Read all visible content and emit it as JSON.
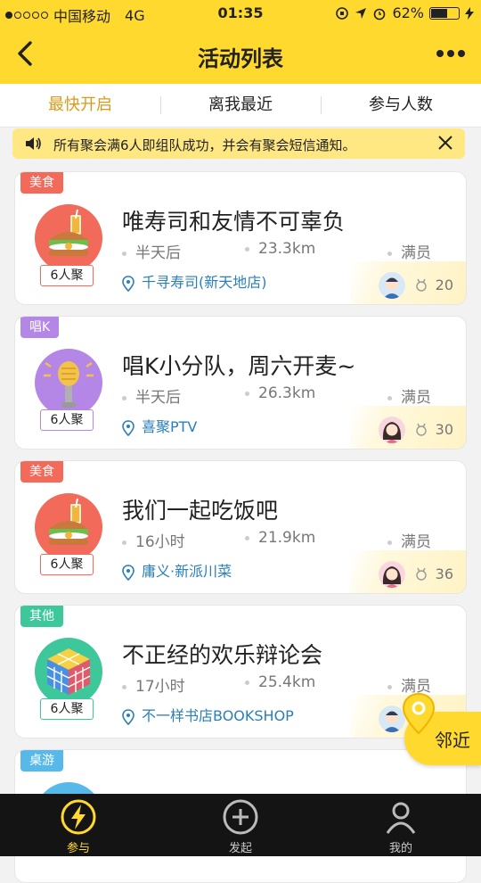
{
  "status_bar": {
    "carrier": "中国移动",
    "network": "4G",
    "time": "01:35",
    "battery": "62%",
    "battery_level": 0.62,
    "signal_filled": 1,
    "signal_total": 5
  },
  "nav": {
    "title": "活动列表",
    "back_icon": "chevron-left-icon",
    "more_icon": "more-dots-icon"
  },
  "tabs": [
    {
      "label": "最快开启",
      "active": true
    },
    {
      "label": "离我最近",
      "active": false
    },
    {
      "label": "参与人数",
      "active": false
    }
  ],
  "notice": {
    "text": "所有聚会满6人即组队成功，并会有聚会短信通知。",
    "close": "✕"
  },
  "colors": {
    "accent": "#ffd92e",
    "food": "#f26a5a",
    "ktv": "#b487e6",
    "other": "#3ec79a",
    "board": "#57b9e9",
    "link": "#2a7fb8"
  },
  "cards": [
    {
      "category": "美食",
      "category_color": "#f26a5a",
      "icon": "food-sandwich-icon",
      "capacity": "6人聚",
      "title": "唯寿司和友情不可辜负",
      "time": "半天后",
      "distance": "23.3km",
      "status": "满员",
      "location": "千寻寿司(新天地店)",
      "points": "20",
      "avatar": "male-avatar"
    },
    {
      "category": "唱K",
      "category_color": "#b487e6",
      "icon": "microphone-icon",
      "capacity": "6人聚",
      "title": "唱K小分队，周六开麦~",
      "time": "半天后",
      "distance": "26.3km",
      "status": "满员",
      "location": "喜聚PTV",
      "points": "30",
      "avatar": "female-avatar"
    },
    {
      "category": "美食",
      "category_color": "#f26a5a",
      "icon": "food-sandwich-icon",
      "capacity": "6人聚",
      "title": "我们一起吃饭吧",
      "time": "16小时",
      "distance": "21.9km",
      "status": "满员",
      "location": "庸义·新派川菜",
      "points": "36",
      "avatar": "female-avatar"
    },
    {
      "category": "其他",
      "category_color": "#3ec79a",
      "icon": "rubik-cube-icon",
      "capacity": "6人聚",
      "title": "不正经的欢乐辩论会",
      "time": "17小时",
      "distance": "25.4km",
      "status": "满员",
      "location": "不一样书店BOOKSHOP",
      "points": "",
      "avatar": "male-avatar"
    },
    {
      "category": "桌游",
      "category_color": "#57b9e9",
      "icon": "boardgame-icon",
      "capacity": "",
      "title": "",
      "time": "",
      "distance": "",
      "status": "",
      "location": "",
      "points": "",
      "avatar": ""
    }
  ],
  "nearby_button": {
    "label": "邻近"
  },
  "bottom_nav": [
    {
      "label": "参与",
      "icon": "lightning-icon",
      "active": true
    },
    {
      "label": "发起",
      "icon": "create-icon",
      "active": false
    },
    {
      "label": "我的",
      "icon": "user-icon",
      "active": false
    }
  ]
}
